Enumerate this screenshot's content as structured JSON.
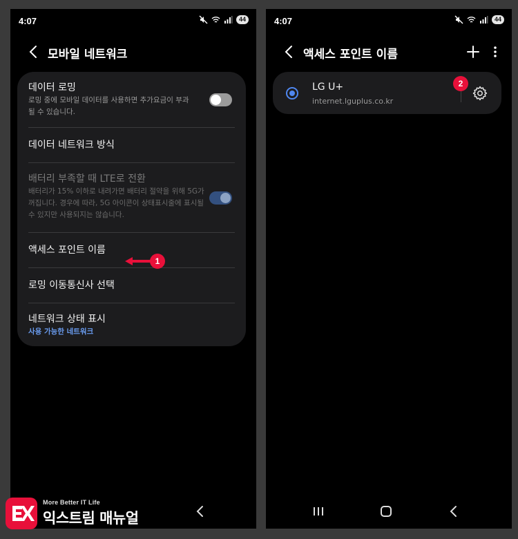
{
  "left_screen": {
    "status": {
      "time": "4:07",
      "battery": "44"
    },
    "title": "모바일 네트워크",
    "items": [
      {
        "title": "데이터 로밍",
        "subtitle": "로밍 중에 모바일 데이터를 사용하면 추가요금이 부과될 수 있습니다.",
        "toggle": "off"
      },
      {
        "title": "데이터 네트워크 방식"
      },
      {
        "title": "배터리 부족할 때 LTE로 전환",
        "subtitle": "배터리가 15% 이하로 내려가면 배터리 절약을 위해 5G가 꺼집니다. 경우에 따라, 5G 아이콘이 상태표시줄에 표시될 수 있지만 사용되지는 않습니다.",
        "toggle": "on",
        "disabled": true
      },
      {
        "title": "액세스 포인트 이름"
      },
      {
        "title": "로밍 이동통신사 선택"
      },
      {
        "title": "네트워크 상태 표시",
        "subtitle": "사용 가능한 네트워크"
      }
    ],
    "callout": "1"
  },
  "right_screen": {
    "status": {
      "time": "4:07",
      "battery": "44"
    },
    "title": "액세스 포인트 이름",
    "apn": {
      "name": "LG U+",
      "url": "internet.lguplus.co.kr"
    },
    "callout": "2"
  },
  "watermark": {
    "tagline": "More Better IT Life",
    "brand": "익스트림 매뉴얼"
  },
  "colors": {
    "accent": "#4f87f0",
    "callout": "#e8103a",
    "card": "#1c1c1e"
  }
}
